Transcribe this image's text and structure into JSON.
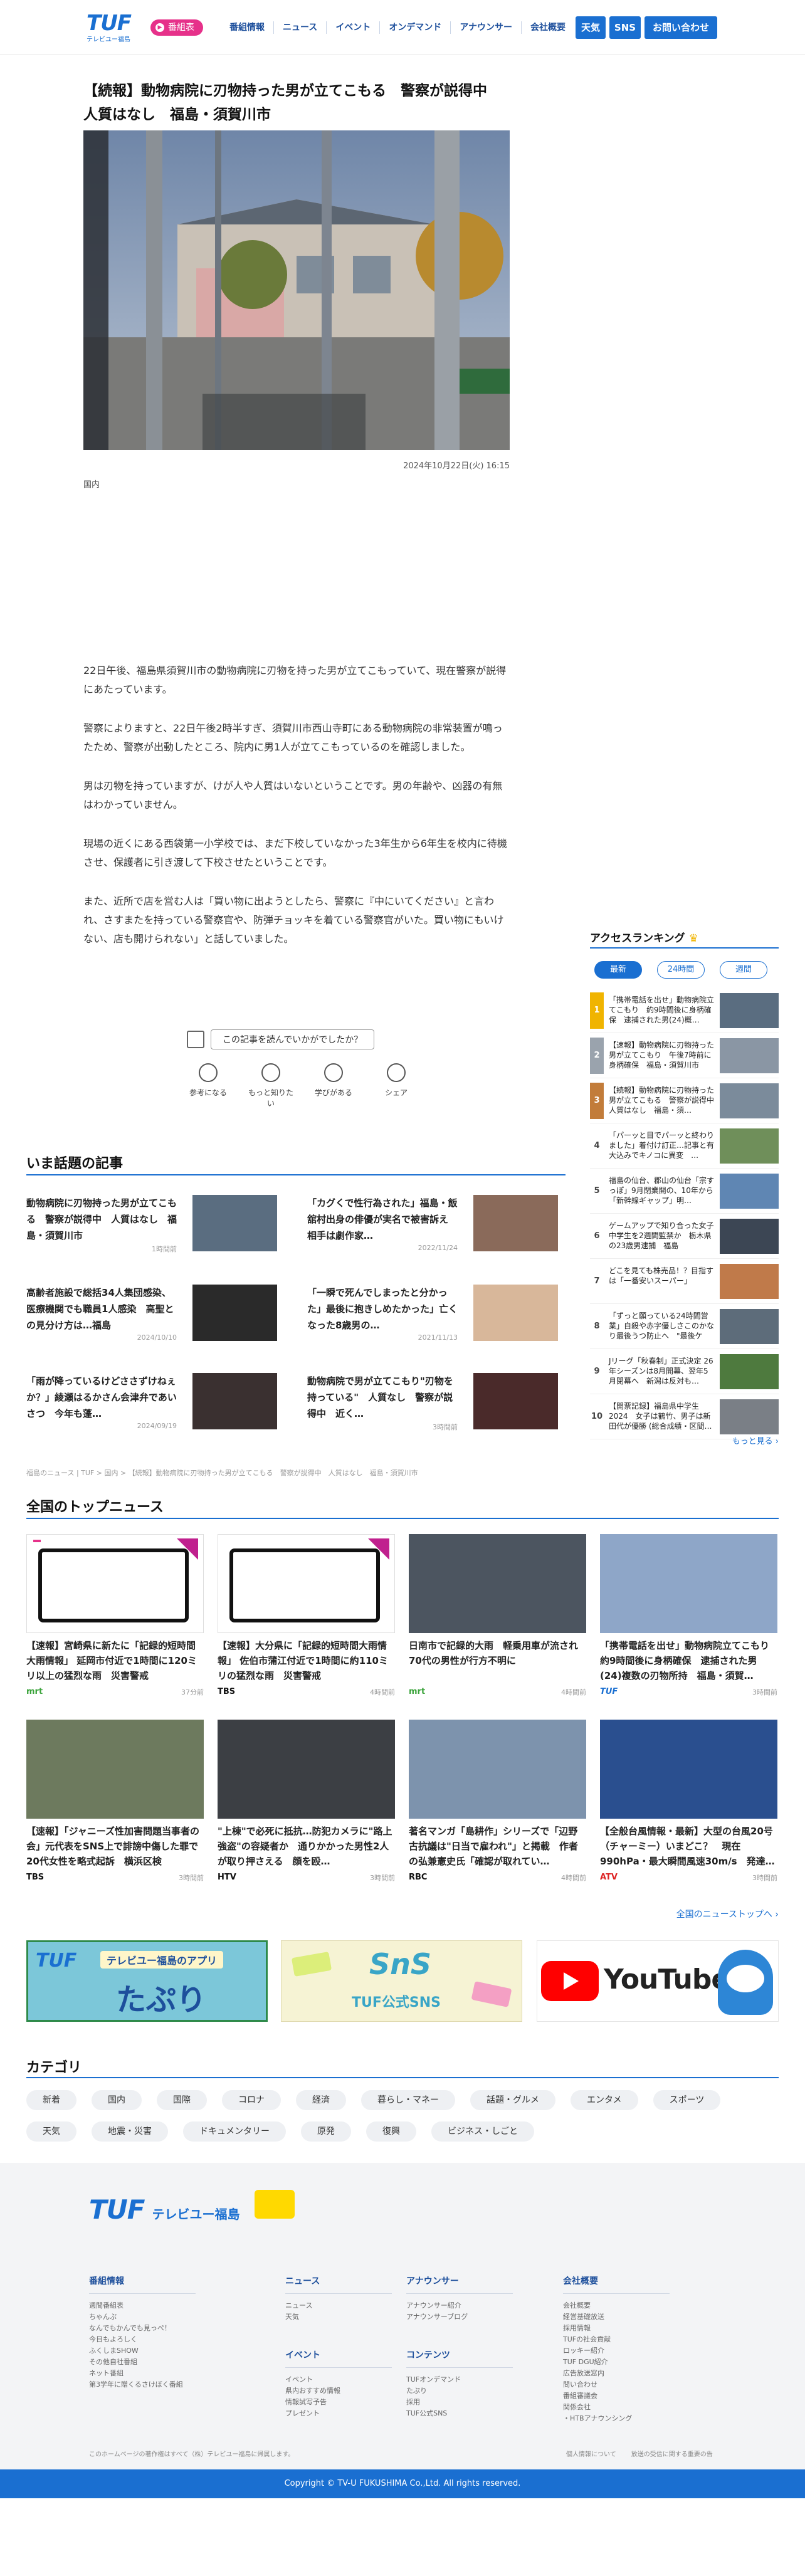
{
  "header": {
    "logo_text": "TUF",
    "logo_sub": "テレビユー福島",
    "bangumi_label": "番組表",
    "nav": [
      "番組情報",
      "ニュース",
      "イベント",
      "オンデマンド",
      "アナウンサー",
      "会社概要"
    ],
    "btn_weather": "天気",
    "btn_sns": "SNS",
    "btn_contact": "お問い合わせ"
  },
  "article": {
    "title": "【続報】動物病院に刃物持った男が立てこもる　警察が説得中　人質はなし　福島・須賀川市",
    "date": "2024年10月22日(火) 16:15",
    "category": "国内",
    "paragraphs": [
      "22日午後、福島県須賀川市の動物病院に刃物を持った男が立てこもっていて、現在警察が説得にあたっています。",
      "警察によりますと、22日午後2時半すぎ、須賀川市西山寺町にある動物病院の非常装置が鳴ったため、警察が出動したところ、院内に男1人が立てこもっているのを確認しました。",
      "男は刃物を持っていますが、けが人や人質はいないということです。男の年齢や、凶器の有無はわかっていません。",
      "現場の近くにある西袋第一小学校では、まだ下校していなかった3年生から6年生を校内に待機させ、保護者に引き渡して下校させたということです。",
      "また、近所で店を営む人は「買い物に出ようとしたら、警察に『中にいてください』と言われ、さすまたを持っている警察官や、防弾チョッキを着ている警察官がいた。買い物にもいけない、店も開けられない」と話していました。"
    ],
    "reaction_question": "この記事を読んでいかがでしたか？",
    "reactions": [
      "参考になる",
      "もっと知りたい",
      "学びがある",
      "シェア"
    ]
  },
  "ranking": {
    "title": "アクセスランキング",
    "tabs": [
      "最新",
      "24時間",
      "週間"
    ],
    "items": [
      {
        "rank": "1",
        "text": "「携帯電話を出せ」動物病院立てこもり　約9時間後に身柄確保　逮捕された男(24)概…"
      },
      {
        "rank": "2",
        "text": "【速報】動物病院に刃物持った男が立てこもり　午後7時前に身柄確保　福島・須賀川市"
      },
      {
        "rank": "3",
        "text": "【続報】動物病院に刃物持った男が立てこもる　警察が説得中　人質はなし　福島・須…"
      },
      {
        "rank": "4",
        "text": "「パーッと目でパーッと終わりました」着付け訂正…記事と有大込みでキノコに異変　…"
      },
      {
        "rank": "5",
        "text": "福島の仙台、郡山の仙台「宗すっぽ」9月閉業開の、10年から「新幹線ギャップ」明…"
      },
      {
        "rank": "6",
        "text": "ゲームアップで知り合った女子中学生を2週間監禁か　栃木県の23歳男逮捕　福島"
      },
      {
        "rank": "7",
        "text": "どこを見ても株売品！？目指すは「一番安いスーパー」"
      },
      {
        "rank": "8",
        "text": "「ずっと願っている24時間営業」自殺や赤字優しさこのかなり最後うつ防止へ　\"最後ケア\"…"
      },
      {
        "rank": "9",
        "text": "Jリーグ「秋春制」正式決定 26年シーズンは8月開幕、翌年5月閉幕へ　新潟は反対も…"
      },
      {
        "rank": "10",
        "text": "【開票記録】福島県中学生 2024　女子は鶴竹、男子は新田代が優勝 (総合成績・区間…"
      }
    ],
    "more": "もっと見る"
  },
  "popular": {
    "title": "いま話題の記事",
    "items": [
      {
        "title": "動物病院に刃物持った男が立てこもる　警察が説得中　人質はなし　福島・須賀川市",
        "date": "1時間前"
      },
      {
        "title": "「カグくで性行為された」福島・飯舘村出身の俳優が実名で被害訴え　相手は劇作家…",
        "date": "2022/11/24"
      },
      {
        "title": "高齢者施設で総括34人集団感染、医療機関でも職員1人感染　高聖との見分け方は…福島",
        "date": "2024/10/10"
      },
      {
        "title": "「一瞬で死んでしまったと分かった」最後に抱きしめたかった」亡くなった8歳男の…",
        "date": "2021/11/13"
      },
      {
        "title": "「雨が降っているけどささずけねぇか？」綾瀬はるかさん会津弁であいさつ　今年も蓬…",
        "date": "2024/09/19"
      },
      {
        "title": "動物病院で男が立てこもり\"刃物を持っている\"　人質なし　警察が説得中　近く…",
        "date": "3時間前"
      }
    ]
  },
  "breadcrumb": "福島のニュース | TUF > 国内 > 【続報】動物病院に刃物持った男が立てこもる　警察が説得中　人質はなし　福島・須賀川市",
  "topnews": {
    "title": "全国のトップニュース",
    "items": [
      {
        "title": "【速報】宮崎県に新たに「記録的短時間大雨情報」 延岡市付近で1時間に120ミリ以上の猛烈な雨　災害警戒",
        "src": "mrt",
        "time": "37分前"
      },
      {
        "title": "【速報】大分県に「記録的短時間大雨情報」 佐伯市蒲江付近で1時間に約110ミリの猛烈な雨　災害警戒",
        "src": "TBS",
        "time": "4時間前"
      },
      {
        "title": "日南市で記録的大雨　軽乗用車が流され70代の男性が行方不明に",
        "src": "mrt",
        "time": "4時間前"
      },
      {
        "title": "「携帯電話を出せ」動物病院立てこもり　約9時間後に身柄確保　逮捕された男(24)複数の刃物所持　福島・須賀…",
        "src": "TUF",
        "time": "3時間前"
      },
      {
        "title": "【速報】「ジャニーズ性加害問題当事者の会」元代表をSNS上で誹謗中傷した罪で20代女性を略式起訴　横浜区検",
        "src": "TBS",
        "time": "3時間前"
      },
      {
        "title": "\"上棟\"で必死に抵抗…防犯カメラに\"路上強盗\"の容疑者か　通りかかった男性2人が取り押さえる　顔を殴…",
        "src": "HTV",
        "time": "3時間前"
      },
      {
        "title": "著名マンガ「島耕作」シリーズで「辺野古抗議は\"日当で雇われ\"」と掲載　作者の弘兼憲史氏「確認が取れてい…",
        "src": "RBC",
        "time": "4時間前"
      },
      {
        "title": "【全般台風情報・最新】大型の台風20号（チャーミー）いまどこ？　現在990hPa・最大瞬間風速30m/s　発達…",
        "src": "ATV",
        "time": "3時間前"
      }
    ],
    "more": "全国のニューストップへ"
  },
  "banners": {
    "app_title": "テレビユー福島のアプリ",
    "app_name": "たぷり",
    "sns_title": "SnS",
    "sns_sub": "TUF公式SNS",
    "youtube": "YouTube"
  },
  "category": {
    "title": "カテゴリ",
    "tags": [
      "新着",
      "国内",
      "国際",
      "コロナ",
      "経済",
      "暮らし・マネー",
      "話題・グルメ",
      "エンタメ",
      "スポーツ",
      "天気",
      "地震・災害",
      "ドキュメンタリー",
      "原発",
      "復興",
      "ビジネス・しごと"
    ]
  },
  "footer": {
    "logo_text": "TUF",
    "logo_sub": "テレビユー福島",
    "columns": [
      {
        "title": "番組情報",
        "links": [
          "週間番組表",
          "ちゃんぷ",
          "なんでもかんでも見っぺ！",
          "今日もよろしく",
          "ふくしまSHOW",
          "その他自社番組",
          "ネット番組",
          "第3学年に贈くるさけぼく番組"
        ]
      },
      {
        "title": "ニュース",
        "links": [
          "ニュース",
          "天気"
        ]
      },
      {
        "title": "イベント",
        "links": [
          "イベント",
          "県内おすすめ情報",
          "情報試写予告",
          "プレゼント"
        ]
      },
      {
        "title": "アナウンサー",
        "links": [
          "アナウンサー紹介",
          "アナウンサーブログ"
        ]
      },
      {
        "title": "コンテンツ",
        "links": [
          "TUFオンデマンド",
          "たぷり",
          "採用",
          "TUF公式SNS"
        ]
      },
      {
        "title": "会社概要",
        "links": [
          "会社概要",
          "経営基礎放送",
          "採用情報",
          "TUFの社会貢献",
          "ロッキー紹介",
          "TUF DGU紹介",
          "広告放送窓内",
          "問い合わせ",
          "番組審議会",
          "関係会社",
          "・HTBアナウンシング"
        ]
      }
    ],
    "note": "このホームページの著作権はすべて（株）テレビユー福島に帰属します。",
    "links": [
      "個人情報について",
      "放送の受信に関する重要の告"
    ],
    "copyright": "Copyright © TV-U FUKUSHIMA Co.,Ltd. All rights reserved."
  }
}
